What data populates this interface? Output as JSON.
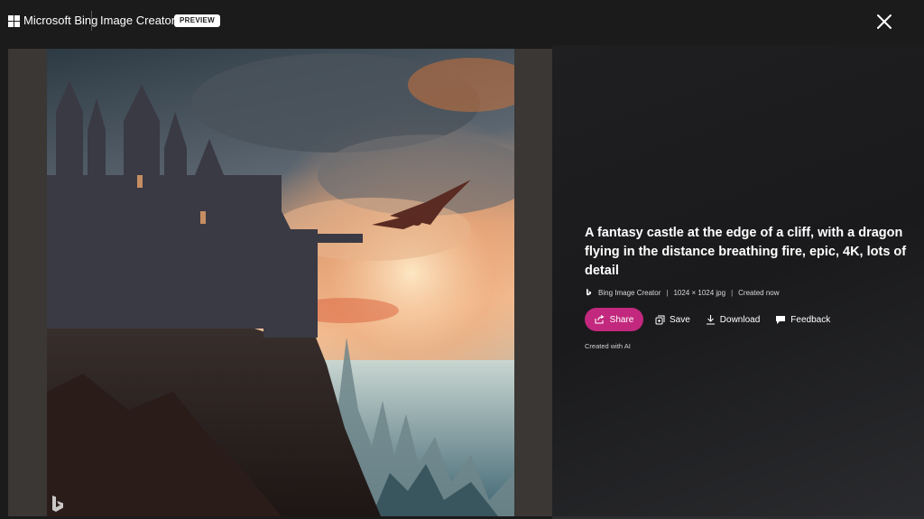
{
  "header": {
    "brand": "Microsoft Bing",
    "product": "Image Creator",
    "badge": "PREVIEW",
    "logo_icon": "microsoft-four-squares-icon",
    "close_icon": "close-icon"
  },
  "image": {
    "description_icon": "generated-artwork",
    "watermark_icon": "bing-b-icon"
  },
  "details": {
    "prompt": "A fantasy castle at the edge of a cliff, with a dragon flying in the distance breathing fire, epic, 4K, lots of detail",
    "source": "Bing Image Creator",
    "dimensions": "1024 × 1024 jpg",
    "created": "Created now",
    "created_with": "Created with AI"
  },
  "actions": {
    "share": "Share",
    "save": "Save",
    "download": "Download",
    "feedback": "Feedback"
  },
  "colors": {
    "background": "#1b1b1b",
    "share_accent": "#c2287d"
  }
}
